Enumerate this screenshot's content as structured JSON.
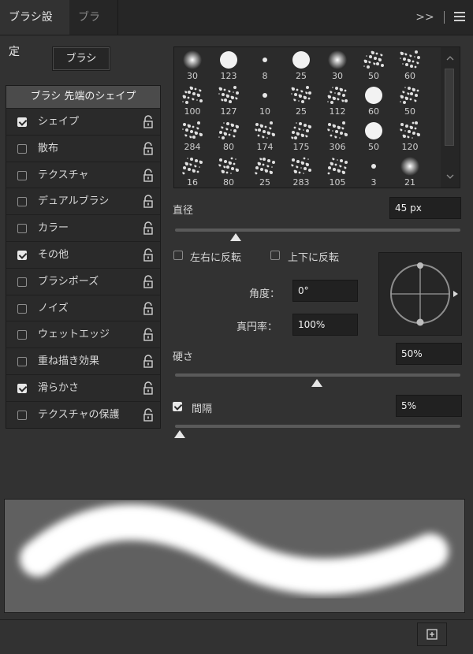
{
  "tabs": [
    {
      "label": "ブラシ設定",
      "active": true
    },
    {
      "label": "ブラシ",
      "active": false
    }
  ],
  "header_actions": {
    "collapse": ">>",
    "menu": "menu-icon"
  },
  "brush_button_label": "ブラシ",
  "sidebar": {
    "header": "ブラシ 先端のシェイプ",
    "items": [
      {
        "label": "シェイプ",
        "checked": true
      },
      {
        "label": "散布",
        "checked": false
      },
      {
        "label": "テクスチャ",
        "checked": false
      },
      {
        "label": "デュアルブラシ",
        "checked": false
      },
      {
        "label": "カラー",
        "checked": false
      },
      {
        "label": "その他",
        "checked": true
      },
      {
        "label": "ブラシポーズ",
        "checked": false
      },
      {
        "label": "ノイズ",
        "checked": false
      },
      {
        "label": "ウェットエッジ",
        "checked": false
      },
      {
        "label": "重ね描き効果",
        "checked": false
      },
      {
        "label": "滑らかさ",
        "checked": true
      },
      {
        "label": "テクスチャの保護",
        "checked": false
      }
    ]
  },
  "presets": {
    "rows": [
      [
        "30",
        "123",
        "8",
        "25",
        "30",
        "50",
        "60"
      ],
      [
        "100",
        "127",
        "10",
        "25",
        "112",
        "60",
        "50"
      ],
      [
        "284",
        "80",
        "174",
        "175",
        "306",
        "50",
        "120"
      ],
      [
        "16",
        "80",
        "25",
        "283",
        "105",
        "3",
        "21"
      ]
    ]
  },
  "diameter": {
    "label": "直径",
    "value": "45 px",
    "fraction": 0.21
  },
  "flip_x": {
    "label": "左右に反転",
    "checked": false
  },
  "flip_y": {
    "label": "上下に反転",
    "checked": false
  },
  "angle": {
    "label": "角度：",
    "value": "0°"
  },
  "roundness": {
    "label": "真円率：",
    "value": "100%"
  },
  "hardness": {
    "label": "硬さ",
    "value": "50%",
    "fraction": 0.5
  },
  "spacing": {
    "label": "間隔",
    "value": "5%",
    "checked": true,
    "fraction": 0.03
  },
  "colors": {
    "accent": "#e6e6e6",
    "panel": "#323232",
    "list": "#2a2a2a",
    "header": "#4b4b4b"
  }
}
